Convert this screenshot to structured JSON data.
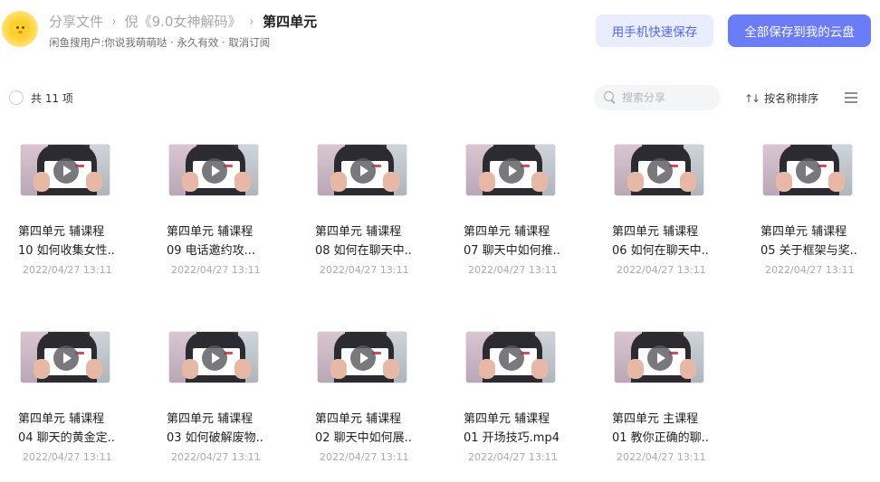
{
  "header": {
    "avatar_icon": "chick-avatar-icon",
    "breadcrumb": [
      "分享文件",
      "倪《9.0女神解码》",
      "第四单元"
    ],
    "separator": "›",
    "subtitle_user": "闲鱼搜用户:你说我萌萌哒",
    "subtitle_validity": "永久有效",
    "subtitle_cancel": "取消订阅",
    "subtitle_dot": "·",
    "phone_save_label": "用手机快速保存",
    "save_all_label": "全部保存到我的云盘"
  },
  "toolbar": {
    "count_label": "共 11 项",
    "search_placeholder": "搜索分享",
    "sort_label": "按名称排序",
    "sort_icon": "sort-arrows-icon",
    "menu_icon": "list-menu-icon"
  },
  "colors": {
    "accent": "#6a7cf6",
    "accent_light": "#e9edfd",
    "muted_text": "#a5a8ad"
  },
  "files": [
    {
      "line1": "第四单元 辅课程",
      "line2": "10 如何收集女性..",
      "date": "2022/04/27 13:11"
    },
    {
      "line1": "第四单元 辅课程",
      "line2": " 09 电话邀约攻...",
      "date": "2022/04/27 13:11"
    },
    {
      "line1": "第四单元 辅课程",
      "line2": "08 如何在聊天中..",
      "date": "2022/04/27 13:11"
    },
    {
      "line1": "第四单元 辅课程",
      "line2": "07 聊天中如何推..",
      "date": "2022/04/27 13:11"
    },
    {
      "line1": "第四单元 辅课程",
      "line2": "06 如何在聊天中..",
      "date": "2022/04/27 13:11"
    },
    {
      "line1": "第四单元 辅课程",
      "line2": "05 关于框架与奖..",
      "date": "2022/04/27 13:11"
    },
    {
      "line1": "第四单元 辅课程",
      "line2": "04 聊天的黄金定..",
      "date": "2022/04/27 13:11"
    },
    {
      "line1": "第四单元 辅课程",
      "line2": "03 如何破解废物..",
      "date": "2022/04/27 13:11"
    },
    {
      "line1": "第四单元 辅课程",
      "line2": "02 聊天中如何展..",
      "date": "2022/04/27 13:11"
    },
    {
      "line1": "第四单元 辅课程",
      "line2": "01 开场技巧.mp4",
      "date": "2022/04/27 13:11"
    },
    {
      "line1": "第四单元 主课程",
      "line2": "01 教你正确的聊..",
      "date": "2022/04/27 13:11"
    }
  ]
}
